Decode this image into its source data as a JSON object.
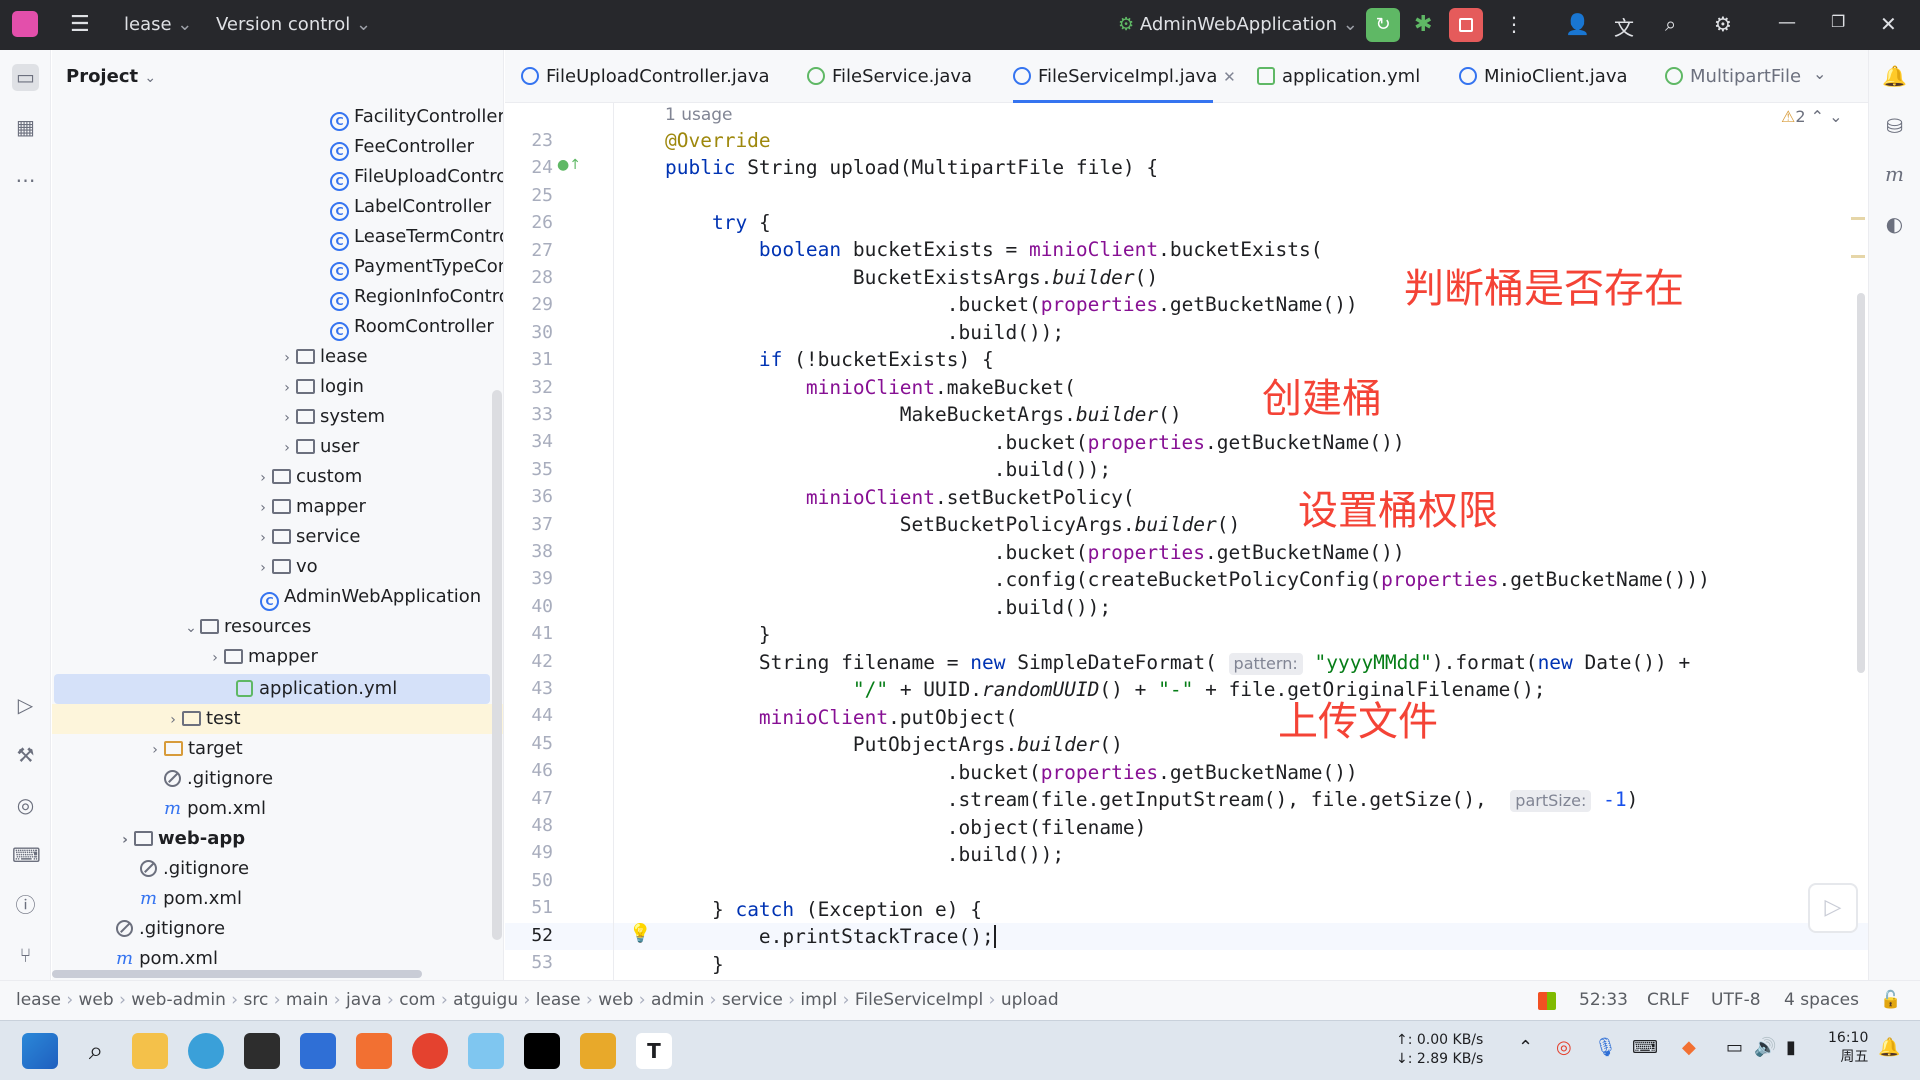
{
  "titlebar": {
    "project": "lease",
    "vcs": "Version control",
    "run_config": "AdminWebApplication"
  },
  "project_panel": {
    "title": "Project",
    "tree": [
      {
        "label": "FacilityController",
        "kind": "class"
      },
      {
        "label": "FeeController",
        "kind": "class"
      },
      {
        "label": "FileUploadControll",
        "kind": "class"
      },
      {
        "label": "LabelController",
        "kind": "class"
      },
      {
        "label": "LeaseTermControl",
        "kind": "class"
      },
      {
        "label": "PaymentTypeCont",
        "kind": "class"
      },
      {
        "label": "RegionInfoControll",
        "kind": "class"
      },
      {
        "label": "RoomController",
        "kind": "class"
      },
      {
        "label": "lease",
        "kind": "package"
      },
      {
        "label": "login",
        "kind": "package"
      },
      {
        "label": "system",
        "kind": "package"
      },
      {
        "label": "user",
        "kind": "package"
      },
      {
        "label": "custom",
        "kind": "package"
      },
      {
        "label": "mapper",
        "kind": "package"
      },
      {
        "label": "service",
        "kind": "package"
      },
      {
        "label": "vo",
        "kind": "package"
      },
      {
        "label": "AdminWebApplication",
        "kind": "class"
      },
      {
        "label": "resources",
        "kind": "folder"
      },
      {
        "label": "mapper",
        "kind": "folder"
      },
      {
        "label": "application.yml",
        "kind": "yml"
      },
      {
        "label": "test",
        "kind": "folder"
      },
      {
        "label": "target",
        "kind": "folder"
      },
      {
        "label": ".gitignore",
        "kind": "ignore"
      },
      {
        "label": "pom.xml",
        "kind": "maven"
      },
      {
        "label": "web-app",
        "kind": "module"
      },
      {
        "label": ".gitignore",
        "kind": "ignore"
      },
      {
        "label": "pom.xml",
        "kind": "maven"
      },
      {
        "label": ".gitignore",
        "kind": "ignore"
      },
      {
        "label": "pom.xml",
        "kind": "maven"
      }
    ]
  },
  "tabs": [
    {
      "label": "FileUploadController.java"
    },
    {
      "label": "FileService.java"
    },
    {
      "label": "FileServiceImpl.java",
      "active": true
    },
    {
      "label": "application.yml"
    },
    {
      "label": "MinioClient.java"
    },
    {
      "label": "MultipartFile"
    }
  ],
  "editor": {
    "usage_hint": "1 usage",
    "warnings": "2",
    "line_numbers": [
      "23",
      "24",
      "25",
      "26",
      "27",
      "28",
      "29",
      "30",
      "31",
      "32",
      "33",
      "34",
      "35",
      "36",
      "37",
      "38",
      "39",
      "40",
      "41",
      "42",
      "43",
      "44",
      "45",
      "46",
      "47",
      "48",
      "49",
      "50",
      "51",
      "52",
      "53"
    ],
    "hint_pattern": "pattern:",
    "hint_partsize": "partSize:",
    "annotations": [
      "判断桶是否存在",
      "创建桶",
      "设置桶权限",
      "上传文件"
    ]
  },
  "breadcrumb": [
    "lease",
    "web",
    "web-admin",
    "src",
    "main",
    "java",
    "com",
    "atguigu",
    "lease",
    "web",
    "admin",
    "service",
    "impl",
    "FileServiceImpl",
    "upload"
  ],
  "status": {
    "position": "52:33",
    "line_sep": "CRLF",
    "encoding": "UTF-8",
    "indent": "4 spaces"
  },
  "taskbar": {
    "net_up": "↑: 0.00 KB/s",
    "net_down": "↓: 2.89 KB/s",
    "time": "16:10",
    "day": "周五"
  },
  "colors": {
    "accent": "#3574f0",
    "annotation": "#f44336",
    "keyword": "#0033b3",
    "field": "#871094",
    "string": "#067d17"
  }
}
